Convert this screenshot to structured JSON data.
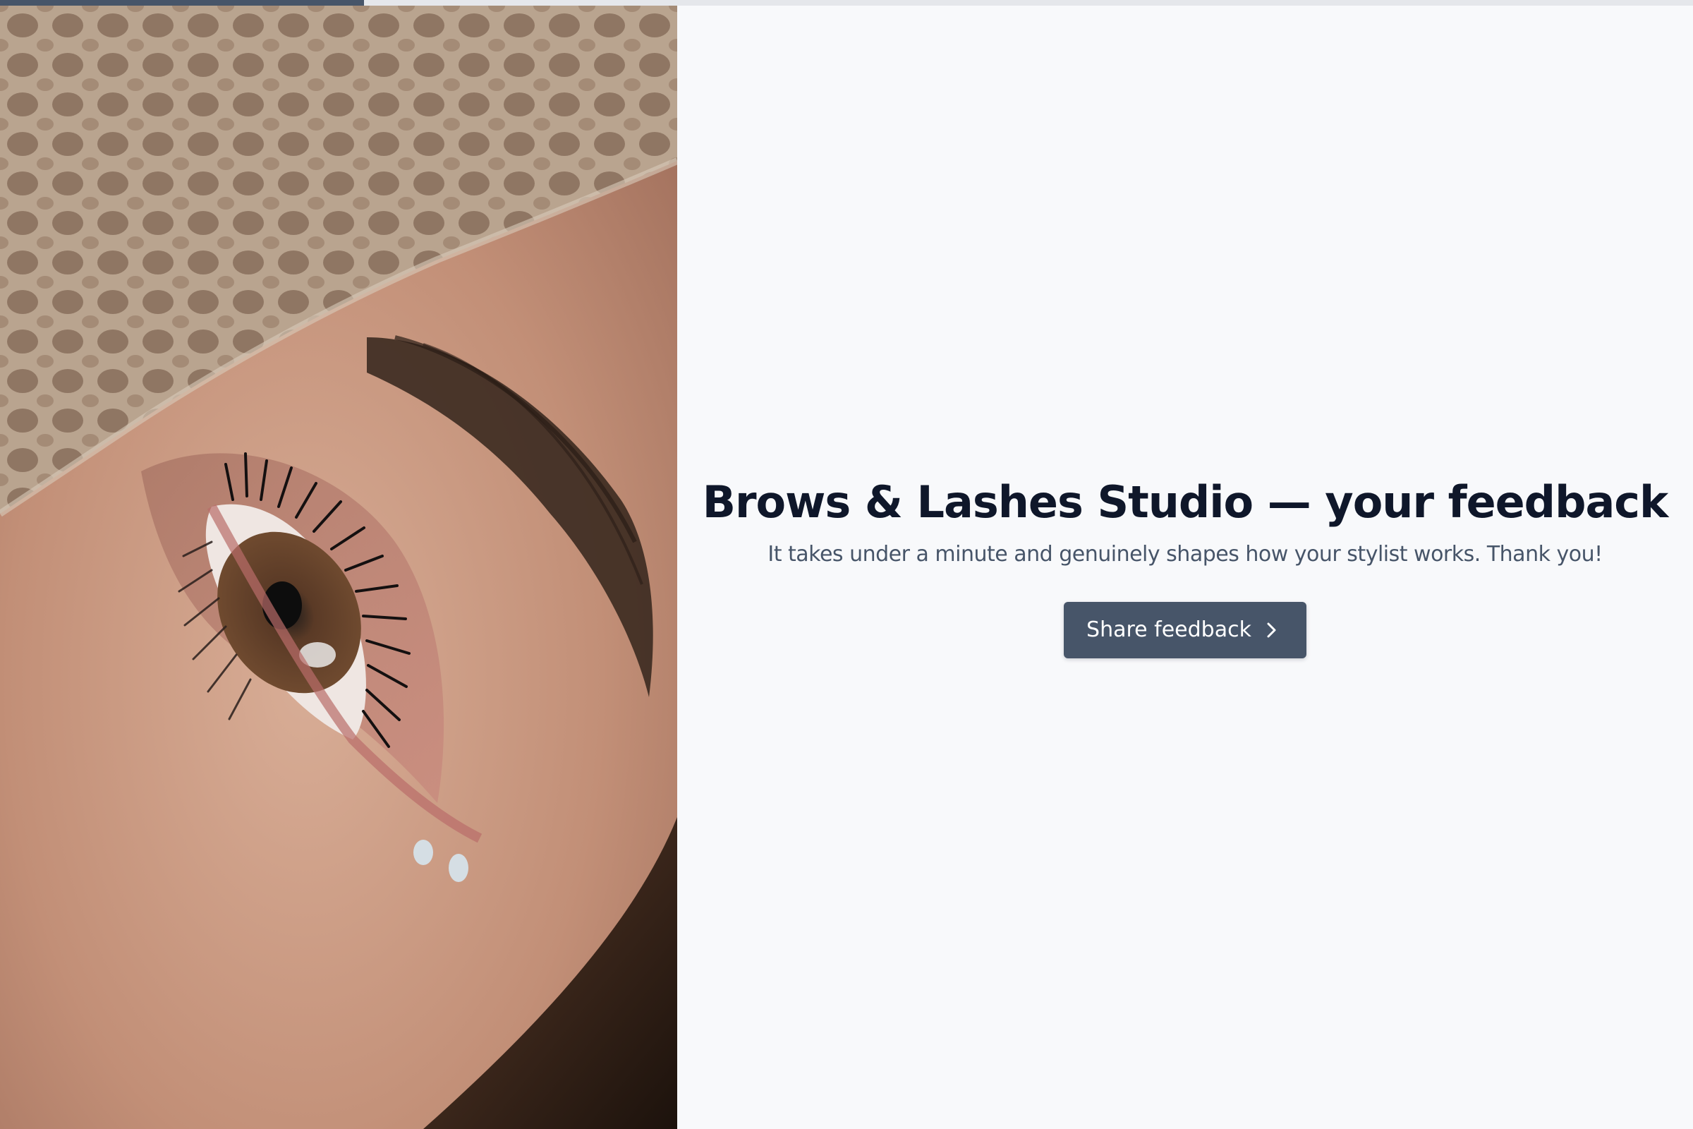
{
  "progress": {
    "fraction": 0.215,
    "track_color": "#e5e7eb",
    "fill_color": "#475569"
  },
  "hero": {
    "image_alt": "Close-up of a woman's eye with long lashes and groomed brow",
    "headline": "Brows & Lashes Studio — your feedback",
    "subtitle": "It takes under a minute and genuinely shapes how your stylist works. Thank you!"
  },
  "cta": {
    "label": "Share feedback",
    "icon": "chevron-right-icon",
    "background_color": "#475569"
  },
  "colors": {
    "page_background": "#f8f9fb",
    "heading": "#0f172a",
    "body_text": "#475569"
  }
}
